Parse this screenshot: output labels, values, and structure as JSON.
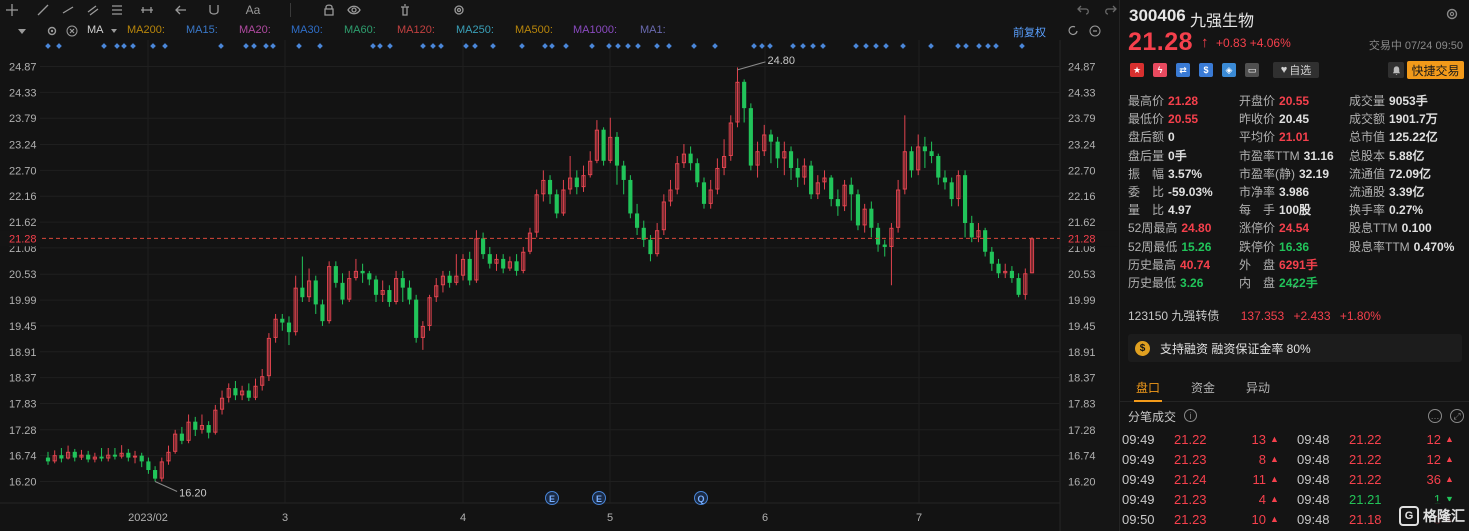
{
  "toolbar": {
    "icons": [
      "crosshair-icon",
      "trend-line-icon",
      "ray-icon",
      "channel-icon",
      "fibonacci-icon",
      "measure-icon",
      "arrow-tool-icon",
      "magnet-icon",
      "lock-icon",
      "eye-icon",
      "delete-icon",
      "settings-icon"
    ],
    "text_tool_label": "Aa"
  },
  "ma_row": {
    "ma_label": "MA",
    "items": [
      {
        "label": "MA200:",
        "color": "#b8860b"
      },
      {
        "label": "MA15:",
        "color": "#3a78c8"
      },
      {
        "label": "MA20:",
        "color": "#b04aa0"
      },
      {
        "label": "MA30:",
        "color": "#2f6ec8"
      },
      {
        "label": "MA60:",
        "color": "#2e9e6e"
      },
      {
        "label": "MA120:",
        "color": "#c04040"
      },
      {
        "label": "MA250:",
        "color": "#3aa0b8"
      },
      {
        "label": "MA500:",
        "color": "#b8860b"
      },
      {
        "label": "MA1000:",
        "color": "#8a4ac0"
      },
      {
        "label": "MA1:",
        "color": "#6a6ab0"
      }
    ],
    "adjust_label": "前复权"
  },
  "chart_data": {
    "type": "candlestick",
    "y_ticks": [
      "24.87",
      "24.33",
      "23.79",
      "23.24",
      "22.70",
      "22.16",
      "21.62",
      "21.08",
      "20.53",
      "19.99",
      "19.45",
      "18.91",
      "18.37",
      "17.83",
      "17.28",
      "16.74",
      "16.20"
    ],
    "x_ticks": [
      "2023/02",
      "3",
      "4",
      "5",
      "6",
      "7"
    ],
    "current_price_label": "21.28",
    "current_price": 21.28,
    "high_annotation": "24.80",
    "high_value": 24.8,
    "low_annotation": "16.20",
    "low_value": 16.2,
    "event_markers": [
      "E",
      "E",
      "Q"
    ],
    "up_color": "#e0434e",
    "down_color": "#21c45a",
    "candles": [
      [
        16.7,
        16.62,
        16.82,
        16.55
      ],
      [
        16.62,
        16.75,
        16.85,
        16.58
      ],
      [
        16.75,
        16.68,
        16.9,
        16.6
      ],
      [
        16.68,
        16.82,
        16.95,
        16.66
      ],
      [
        16.82,
        16.7,
        16.88,
        16.62
      ],
      [
        16.7,
        16.76,
        16.86,
        16.65
      ],
      [
        16.76,
        16.66,
        16.84,
        16.6
      ],
      [
        16.66,
        16.72,
        16.8,
        16.6
      ],
      [
        16.72,
        16.68,
        16.9,
        16.62
      ],
      [
        16.68,
        16.76,
        16.9,
        16.62
      ],
      [
        16.76,
        16.72,
        16.9,
        16.66
      ],
      [
        16.72,
        16.8,
        16.96,
        16.68
      ],
      [
        16.8,
        16.7,
        16.88,
        16.62
      ],
      [
        16.7,
        16.74,
        16.84,
        16.58
      ],
      [
        16.74,
        16.62,
        16.8,
        16.5
      ],
      [
        16.62,
        16.44,
        16.7,
        16.36
      ],
      [
        16.44,
        16.26,
        16.52,
        16.2
      ],
      [
        16.26,
        16.62,
        16.7,
        16.2
      ],
      [
        16.62,
        16.82,
        16.95,
        16.55
      ],
      [
        16.82,
        17.2,
        17.28,
        16.78
      ],
      [
        17.2,
        17.05,
        17.34,
        16.98
      ],
      [
        17.05,
        17.45,
        17.6,
        17.0
      ],
      [
        17.45,
        17.28,
        17.55,
        17.15
      ],
      [
        17.28,
        17.38,
        17.6,
        17.2
      ],
      [
        17.38,
        17.22,
        17.46,
        17.1
      ],
      [
        17.22,
        17.7,
        17.8,
        17.18
      ],
      [
        17.7,
        17.95,
        18.1,
        17.6
      ],
      [
        17.95,
        18.15,
        18.25,
        17.85
      ],
      [
        18.15,
        18.0,
        18.3,
        17.9
      ],
      [
        18.0,
        18.1,
        18.2,
        17.9
      ],
      [
        18.1,
        17.95,
        18.25,
        17.88
      ],
      [
        17.95,
        18.2,
        18.35,
        17.9
      ],
      [
        18.2,
        18.4,
        18.55,
        18.1
      ],
      [
        18.4,
        19.2,
        19.3,
        18.3
      ],
      [
        19.2,
        19.6,
        19.7,
        19.1
      ],
      [
        19.6,
        19.52,
        19.7,
        19.35
      ],
      [
        19.52,
        19.32,
        19.65,
        19.05
      ],
      [
        19.32,
        20.25,
        20.5,
        19.25
      ],
      [
        20.25,
        20.05,
        20.9,
        19.95
      ],
      [
        20.05,
        20.4,
        20.65,
        19.95
      ],
      [
        20.4,
        19.9,
        20.5,
        19.7
      ],
      [
        19.9,
        19.55,
        20.0,
        19.45
      ],
      [
        19.55,
        20.7,
        20.8,
        19.5
      ],
      [
        20.7,
        20.35,
        20.8,
        20.25
      ],
      [
        20.35,
        20.0,
        20.55,
        19.9
      ],
      [
        20.0,
        20.45,
        20.6,
        19.95
      ],
      [
        20.45,
        20.6,
        20.85,
        20.4
      ],
      [
        20.6,
        20.55,
        20.75,
        20.35
      ],
      [
        20.55,
        20.42,
        20.6,
        20.3
      ],
      [
        20.42,
        20.1,
        20.5,
        19.95
      ],
      [
        20.1,
        20.2,
        20.4,
        19.95
      ],
      [
        20.2,
        19.95,
        20.3,
        19.85
      ],
      [
        19.95,
        20.45,
        20.6,
        19.9
      ],
      [
        20.45,
        20.25,
        20.6,
        19.95
      ],
      [
        20.25,
        20.0,
        20.4,
        19.9
      ],
      [
        20.0,
        19.2,
        20.1,
        19.1
      ],
      [
        19.2,
        19.45,
        19.55,
        18.95
      ],
      [
        19.45,
        20.05,
        20.1,
        19.35
      ],
      [
        20.05,
        20.3,
        20.45,
        19.95
      ],
      [
        20.3,
        20.5,
        20.6,
        20.15
      ],
      [
        20.5,
        20.35,
        20.6,
        20.25
      ],
      [
        20.35,
        20.5,
        20.95,
        20.3
      ],
      [
        20.5,
        20.85,
        20.95,
        20.4
      ],
      [
        20.85,
        20.4,
        21.0,
        20.3
      ],
      [
        20.4,
        21.28,
        21.45,
        20.35
      ],
      [
        21.28,
        20.95,
        21.4,
        20.85
      ],
      [
        20.95,
        20.75,
        21.1,
        20.65
      ],
      [
        20.75,
        20.85,
        20.95,
        20.6
      ],
      [
        20.85,
        20.65,
        20.95,
        20.55
      ],
      [
        20.65,
        20.8,
        20.9,
        20.6
      ],
      [
        20.8,
        20.6,
        20.95,
        20.5
      ],
      [
        20.6,
        21.0,
        21.1,
        20.55
      ],
      [
        21.0,
        21.4,
        21.5,
        20.95
      ],
      [
        21.4,
        22.2,
        22.3,
        21.3
      ],
      [
        22.2,
        22.5,
        22.7,
        22.05
      ],
      [
        22.5,
        22.2,
        22.6,
        22.0
      ],
      [
        22.2,
        21.8,
        22.3,
        21.7
      ],
      [
        21.8,
        22.3,
        22.5,
        21.75
      ],
      [
        22.3,
        22.55,
        23.0,
        22.2
      ],
      [
        22.55,
        22.35,
        22.7,
        22.2
      ],
      [
        22.35,
        22.6,
        22.8,
        22.25
      ],
      [
        22.6,
        22.9,
        23.1,
        22.55
      ],
      [
        22.9,
        23.55,
        23.75,
        22.85
      ],
      [
        23.55,
        22.9,
        23.6,
        22.8
      ],
      [
        22.9,
        23.4,
        23.8,
        22.85
      ],
      [
        23.4,
        22.8,
        23.5,
        22.4
      ],
      [
        22.8,
        22.5,
        22.9,
        22.2
      ],
      [
        22.5,
        21.8,
        22.6,
        21.7
      ],
      [
        21.8,
        21.5,
        22.0,
        21.35
      ],
      [
        21.5,
        21.25,
        21.65,
        21.1
      ],
      [
        21.25,
        20.95,
        21.35,
        20.8
      ],
      [
        20.95,
        21.45,
        21.6,
        20.9
      ],
      [
        21.45,
        22.05,
        22.2,
        21.35
      ],
      [
        22.05,
        22.3,
        22.5,
        21.95
      ],
      [
        22.3,
        22.85,
        23.0,
        22.2
      ],
      [
        22.85,
        23.05,
        23.25,
        22.75
      ],
      [
        23.05,
        22.85,
        23.2,
        22.7
      ],
      [
        22.85,
        22.45,
        22.95,
        22.35
      ],
      [
        22.45,
        22.0,
        22.55,
        21.9
      ],
      [
        22.0,
        22.3,
        22.5,
        21.9
      ],
      [
        22.3,
        22.75,
        22.95,
        22.2
      ],
      [
        22.75,
        23.0,
        23.35,
        22.6
      ],
      [
        23.0,
        23.7,
        23.85,
        22.9
      ],
      [
        23.7,
        24.55,
        24.85,
        23.6
      ],
      [
        24.55,
        24.0,
        24.6,
        23.7
      ],
      [
        24.0,
        22.8,
        24.1,
        22.7
      ],
      [
        22.8,
        23.1,
        23.3,
        22.55
      ],
      [
        23.1,
        23.45,
        23.65,
        23.0
      ],
      [
        23.45,
        23.3,
        23.55,
        22.85
      ],
      [
        23.3,
        22.95,
        23.4,
        22.75
      ],
      [
        22.95,
        23.1,
        23.3,
        22.6
      ],
      [
        23.1,
        22.75,
        23.2,
        22.5
      ],
      [
        22.75,
        22.55,
        22.95,
        22.35
      ],
      [
        22.55,
        22.8,
        22.95,
        22.4
      ],
      [
        22.8,
        22.2,
        22.9,
        22.1
      ],
      [
        22.2,
        22.45,
        22.6,
        22.1
      ],
      [
        22.45,
        22.55,
        22.7,
        22.3
      ],
      [
        22.55,
        22.1,
        22.6,
        21.95
      ],
      [
        22.1,
        21.95,
        22.3,
        21.75
      ],
      [
        21.95,
        22.4,
        22.5,
        21.85
      ],
      [
        22.4,
        22.2,
        22.55,
        21.65
      ],
      [
        22.2,
        21.55,
        22.3,
        21.45
      ],
      [
        21.55,
        21.9,
        22.0,
        21.4
      ],
      [
        21.9,
        21.5,
        22.05,
        21.3
      ],
      [
        21.5,
        21.15,
        21.6,
        21.0
      ],
      [
        21.15,
        21.1,
        21.25,
        20.9
      ],
      [
        21.1,
        21.5,
        21.6,
        20.3
      ],
      [
        21.5,
        22.3,
        22.5,
        21.4
      ],
      [
        22.3,
        23.1,
        23.85,
        22.2
      ],
      [
        23.1,
        22.7,
        23.2,
        22.55
      ],
      [
        22.7,
        23.2,
        23.45,
        22.6
      ],
      [
        23.2,
        23.1,
        23.4,
        22.75
      ],
      [
        23.1,
        23.0,
        23.3,
        22.85
      ],
      [
        23.0,
        22.55,
        23.05,
        22.4
      ],
      [
        22.55,
        22.45,
        22.7,
        22.3
      ],
      [
        22.45,
        22.1,
        22.55,
        21.95
      ],
      [
        22.1,
        22.6,
        22.7,
        21.95
      ],
      [
        22.6,
        21.6,
        22.7,
        21.3
      ],
      [
        21.6,
        21.3,
        21.75,
        21.2
      ],
      [
        21.3,
        21.45,
        21.6,
        21.2
      ],
      [
        21.45,
        21.0,
        21.5,
        20.9
      ],
      [
        21.0,
        20.75,
        21.1,
        20.6
      ],
      [
        20.75,
        20.55,
        20.85,
        20.45
      ],
      [
        20.55,
        20.6,
        20.75,
        20.45
      ],
      [
        20.6,
        20.45,
        20.7,
        20.35
      ],
      [
        20.45,
        20.1,
        20.55,
        20.05
      ],
      [
        20.1,
        20.55,
        20.65,
        20.0
      ],
      [
        20.55,
        21.28,
        21.3,
        20.55
      ]
    ]
  },
  "quote": {
    "code": "300406",
    "name": "九强生物",
    "price": "21.28",
    "change": "+0.83",
    "change_pct": "+4.06%",
    "status": "交易中 07/24 09:50",
    "zixuan_label": "自选",
    "quick_trade_label": "快捷交易",
    "rows": [
      [
        {
          "l": "最高价",
          "v": "21.28",
          "c": "red"
        },
        {
          "l": "开盘价",
          "v": "20.55",
          "c": "red"
        },
        {
          "l": "成交量",
          "v": "9053手",
          "c": "white"
        }
      ],
      [
        {
          "l": "最低价",
          "v": "20.55",
          "c": "red"
        },
        {
          "l": "昨收价",
          "v": "20.45",
          "c": "white"
        },
        {
          "l": "成交额",
          "v": "1901.7万",
          "c": "white"
        }
      ],
      [
        {
          "l": "盘后额",
          "v": "0",
          "c": "white"
        },
        {
          "l": "平均价",
          "v": "21.01",
          "c": "red"
        },
        {
          "l": "总市值",
          "v": "125.22亿",
          "c": "white"
        }
      ],
      [
        {
          "l": "盘后量",
          "v": "0手",
          "c": "white"
        },
        {
          "l": "市盈率TTM",
          "v": "31.16",
          "c": "white"
        },
        {
          "l": "总股本",
          "v": "5.88亿",
          "c": "white"
        }
      ],
      [
        {
          "l": "振　幅",
          "v": "3.57%",
          "c": "white"
        },
        {
          "l": "市盈率(静)",
          "v": "32.19",
          "c": "white"
        },
        {
          "l": "流通值",
          "v": "72.09亿",
          "c": "white"
        }
      ],
      [
        {
          "l": "委　比",
          "v": "-59.03%",
          "c": "white"
        },
        {
          "l": "市净率",
          "v": "3.986",
          "c": "white"
        },
        {
          "l": "流通股",
          "v": "3.39亿",
          "c": "white"
        }
      ],
      [
        {
          "l": "量　比",
          "v": "4.97",
          "c": "white"
        },
        {
          "l": "每　手",
          "v": "100股",
          "c": "white"
        },
        {
          "l": "换手率",
          "v": "0.27%",
          "c": "white"
        }
      ],
      [
        {
          "l": "52周最高",
          "v": "24.80",
          "c": "red"
        },
        {
          "l": "涨停价",
          "v": "24.54",
          "c": "red"
        },
        {
          "l": "股息TTM",
          "v": "0.100",
          "c": "white"
        }
      ],
      [
        {
          "l": "52周最低",
          "v": "15.26",
          "c": "green"
        },
        {
          "l": "跌停价",
          "v": "16.36",
          "c": "green"
        },
        {
          "l": "股息率TTM",
          "v": "0.470%",
          "c": "white"
        }
      ],
      [
        {
          "l": "历史最高",
          "v": "40.74",
          "c": "red"
        },
        {
          "l": "外　盘",
          "v": "6291手",
          "c": "red"
        },
        {
          "l": "",
          "v": "",
          "c": "white"
        }
      ],
      [
        {
          "l": "历史最低",
          "v": "3.26",
          "c": "green"
        },
        {
          "l": "内　盘",
          "v": "2422手",
          "c": "green"
        },
        {
          "l": "",
          "v": "",
          "c": "white"
        }
      ]
    ],
    "convertible": {
      "code": "123150",
      "name": "九强转债",
      "price": "137.353",
      "change": "+2.433",
      "pct": "+1.80%"
    },
    "margin_text": "支持融资 融资保证金率 80%",
    "tabs": [
      "盘口",
      "资金",
      "异动"
    ],
    "trades_title": "分笔成交",
    "trades_left": [
      {
        "t": "09:49",
        "p": "21.22",
        "v": "13",
        "c": "red"
      },
      {
        "t": "09:49",
        "p": "21.23",
        "v": "8",
        "c": "red"
      },
      {
        "t": "09:49",
        "p": "21.24",
        "v": "11",
        "c": "red"
      },
      {
        "t": "09:49",
        "p": "21.23",
        "v": "4",
        "c": "red"
      },
      {
        "t": "09:50",
        "p": "21.23",
        "v": "10",
        "c": "red"
      }
    ],
    "trades_right": [
      {
        "t": "09:48",
        "p": "21.22",
        "v": "12",
        "c": "red"
      },
      {
        "t": "09:48",
        "p": "21.22",
        "v": "12",
        "c": "red"
      },
      {
        "t": "09:48",
        "p": "21.22",
        "v": "36",
        "c": "red"
      },
      {
        "t": "09:48",
        "p": "21.21",
        "v": "1",
        "c": "green"
      },
      {
        "t": "09:48",
        "p": "21.18",
        "v": "6",
        "c": "red"
      }
    ],
    "logo_text": "格隆汇"
  }
}
